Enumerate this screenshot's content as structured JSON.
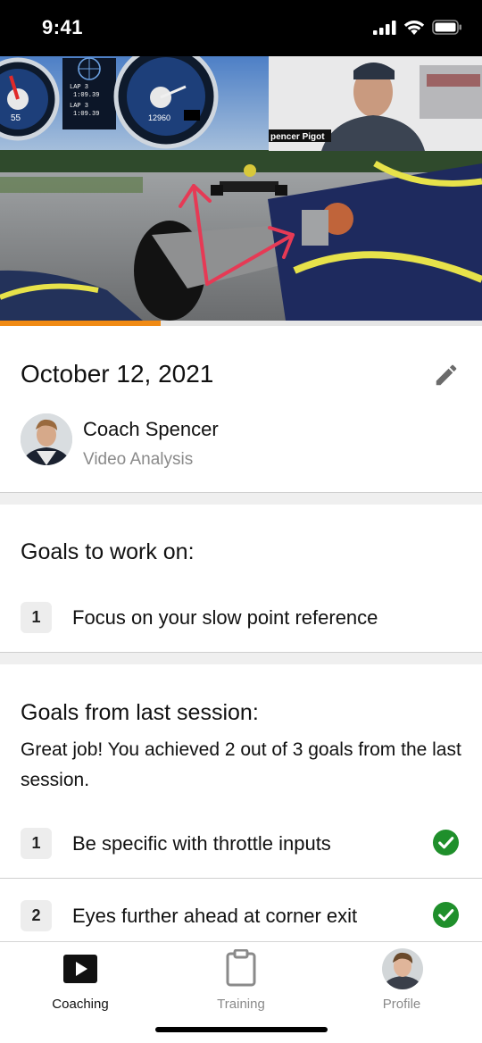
{
  "status_bar": {
    "time": "9:41"
  },
  "video": {
    "overlay_texts": [
      "LAP 3",
      "1:09.39",
      "LAP 3",
      "1:09.39",
      "55",
      "12960"
    ],
    "webcam_name": "pencer Pigot",
    "progress_fraction": 0.333,
    "accent_color": "#f08a14",
    "annotation_color": "#e63a55"
  },
  "session": {
    "date": "October 12, 2021",
    "coach_name": "Coach Spencer",
    "coach_role": "Video Analysis"
  },
  "goals": {
    "title": "Goals to work on:",
    "items": [
      {
        "number": "1",
        "text": "Focus on your slow point reference"
      }
    ]
  },
  "last_session": {
    "title": "Goals from last session:",
    "summary": "Great job! You achieved 2 out of 3 goals from the last session.",
    "items": [
      {
        "number": "1",
        "text": "Be specific with throttle inputs",
        "achieved": true
      },
      {
        "number": "2",
        "text": "Eyes further ahead at corner exit",
        "achieved": true
      }
    ],
    "check_color": "#1f8f2b"
  },
  "tab_bar": {
    "tabs": [
      {
        "label": "Coaching",
        "icon": "play-icon",
        "active": true
      },
      {
        "label": "Training",
        "icon": "clipboard-icon",
        "active": false
      },
      {
        "label": "Profile",
        "icon": "profile-avatar",
        "active": false
      }
    ]
  }
}
